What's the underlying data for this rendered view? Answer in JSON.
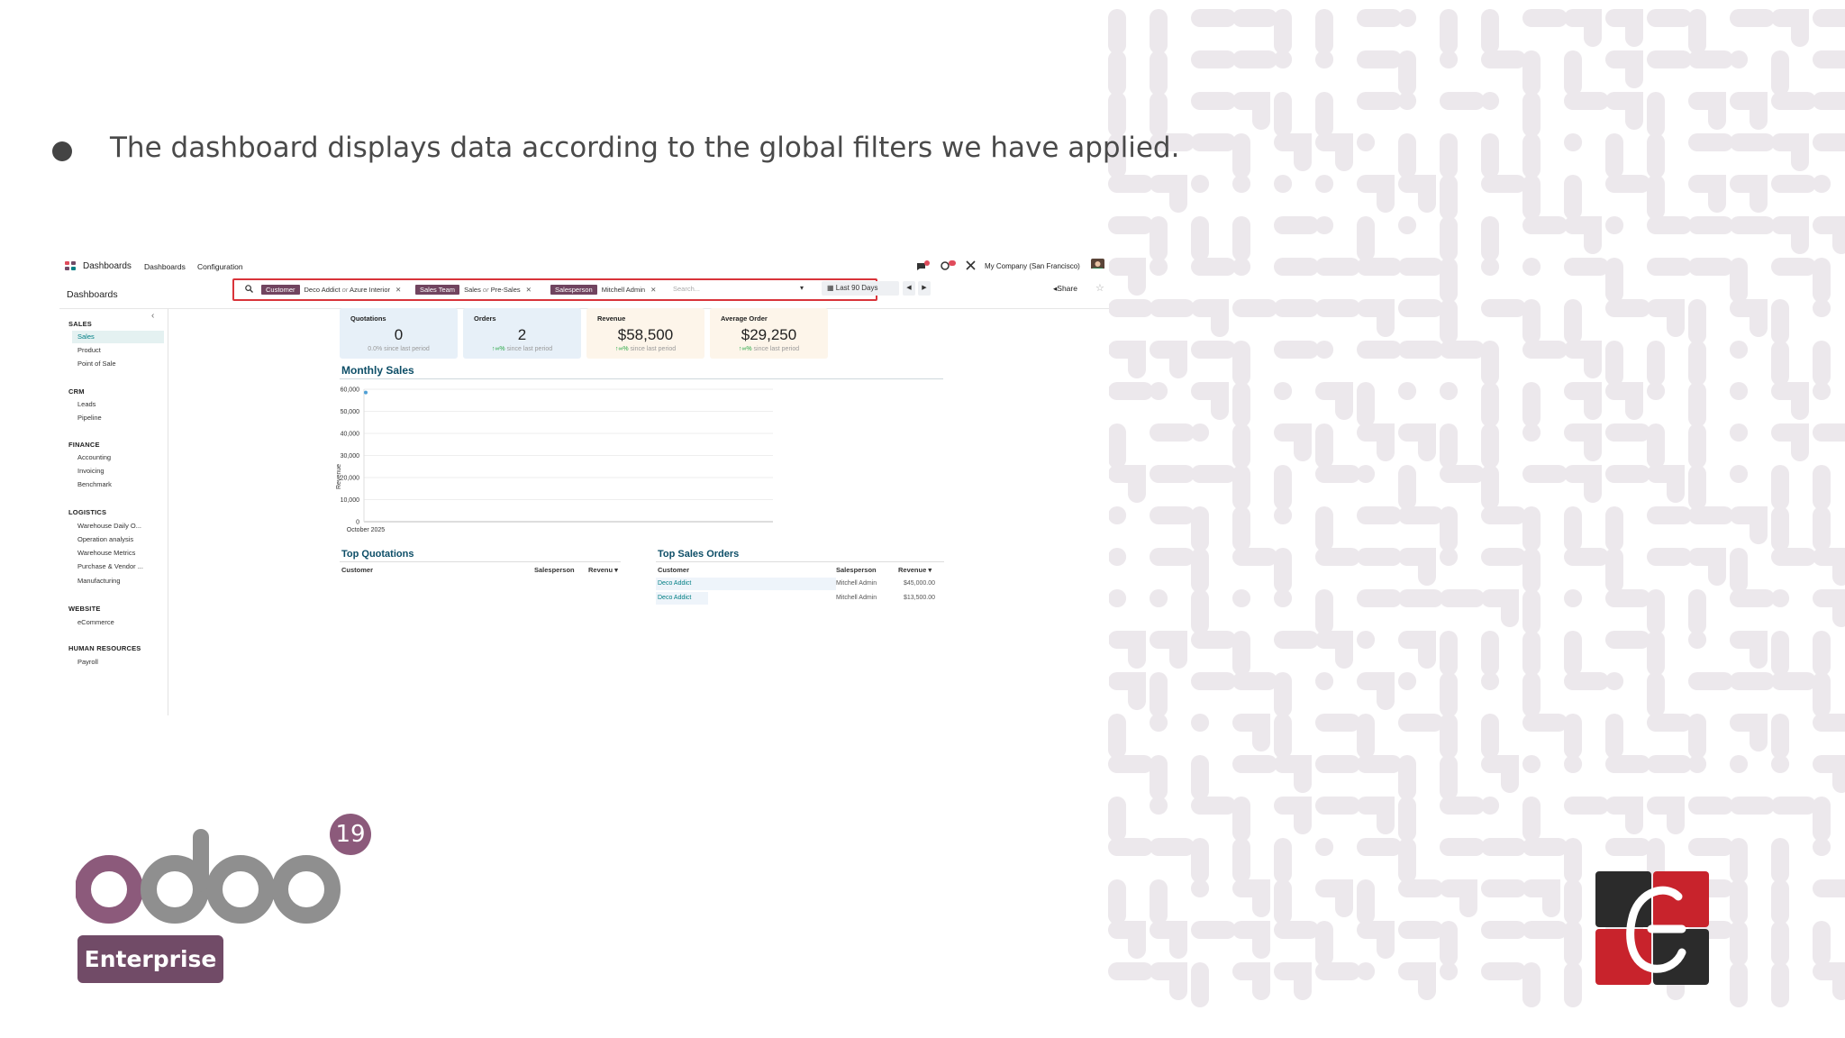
{
  "slide": {
    "text": "The dashboard displays data according to the global filters we have applied."
  },
  "app": {
    "name": "Dashboards",
    "menu": [
      "Dashboards",
      "Configuration"
    ],
    "company": "My Company (San Francisco)",
    "breadcrumb": "Dashboards"
  },
  "search": {
    "facets": [
      {
        "tag": "Customer",
        "value_a": "Deco Addict",
        "or": "or",
        "value_b": "Azure Interior"
      },
      {
        "tag": "Sales Team",
        "value_a": "Sales",
        "or": "or",
        "value_b": "Pre-Sales"
      },
      {
        "tag": "Salesperson",
        "value_a": "Mitchell Admin"
      }
    ],
    "placeholder": "Search..."
  },
  "date_filter": "Last 90 Days",
  "share_label": "Share",
  "sidebar": {
    "sections": [
      {
        "title": "SALES",
        "items": [
          "Sales",
          "Product",
          "Point of Sale"
        ]
      },
      {
        "title": "CRM",
        "items": [
          "Leads",
          "Pipeline"
        ]
      },
      {
        "title": "FINANCE",
        "items": [
          "Accounting",
          "Invoicing",
          "Benchmark"
        ]
      },
      {
        "title": "LOGISTICS",
        "items": [
          "Warehouse Daily O...",
          "Operation analysis",
          "Warehouse Metrics",
          "Purchase & Vendor ...",
          "Manufacturing"
        ]
      },
      {
        "title": "WEBSITE",
        "items": [
          "eCommerce"
        ]
      },
      {
        "title": "HUMAN RESOURCES",
        "items": [
          "Payroll"
        ]
      }
    ],
    "active_item": "Sales"
  },
  "kpis": [
    {
      "title": "Quotations",
      "value": "0",
      "trend": "0.0% since last period",
      "bg": "#e7f0f8"
    },
    {
      "title": "Orders",
      "value": "2",
      "trend": "↑∞% since last period",
      "bg": "#e7f0f8"
    },
    {
      "title": "Revenue",
      "value": "$58,500",
      "trend": "↑∞% since last period",
      "bg": "#fdf5ea"
    },
    {
      "title": "Average Order",
      "value": "$29,250",
      "trend": "↑∞% since last period",
      "bg": "#fdf5ea"
    }
  ],
  "monthly_sales": {
    "title": "Monthly Sales",
    "chart_data": {
      "type": "line",
      "categories": [
        "October 2025"
      ],
      "series": [
        {
          "values": [
            58500
          ]
        }
      ],
      "ylabel": "Revenue",
      "yticks": [
        "0",
        "10,000",
        "20,000",
        "30,000",
        "40,000",
        "50,000",
        "60,000"
      ],
      "ylim": [
        0,
        60000
      ],
      "grid": true,
      "color": "#4e9fd5"
    }
  },
  "top_quotations": {
    "title": "Top Quotations",
    "columns": [
      "Customer",
      "Salesperson",
      "Revenu ▾"
    ],
    "rows": []
  },
  "top_sales_orders": {
    "title": "Top Sales Orders",
    "columns": [
      "Customer",
      "Salesperson",
      "Revenue ▾"
    ],
    "rows": [
      {
        "customer": "Deco Addict",
        "salesperson": "Mitchell Admin",
        "revenue": "$45,000.00"
      },
      {
        "customer": "Deco Addict",
        "salesperson": "Mitchell Admin",
        "revenue": "$13,500.00"
      }
    ]
  },
  "branding": {
    "version": "19",
    "edition": "Enterprise",
    "logo_text": "odoo"
  },
  "colors": {
    "odoo_purple": "#714b67",
    "odoo_gray": "#8f8f8f",
    "teal": "#017e84",
    "highlight": "#d9343a"
  }
}
